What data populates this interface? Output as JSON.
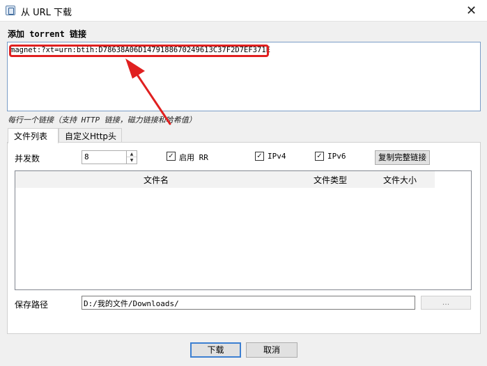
{
  "window": {
    "title": "从 URL 下载",
    "close_glyph": "✕"
  },
  "section_title": "添加 torrent 链接",
  "links_text": "magnet:?xt=urn:btih:D78638A06D1479188670249613C37F2D7EF371E",
  "hint": "每行一个链接（支持 HTTP 链接，磁力链接和哈希值）",
  "tabs": [
    {
      "label": "文件列表",
      "active": true
    },
    {
      "label": "自定义Http头",
      "active": false
    }
  ],
  "options": {
    "concurrency_label": "并发数",
    "concurrency_value": "8",
    "enable_rr_label": "启用 RR",
    "enable_rr_checked": true,
    "ipv4_label": "IPv4",
    "ipv4_checked": true,
    "ipv6_label": "IPv6",
    "ipv6_checked": true,
    "copy_link_button": "复制完整链接"
  },
  "file_list": {
    "columns": [
      "文件名",
      "文件类型",
      "文件大小"
    ],
    "rows": []
  },
  "save_path": {
    "label": "保存路径",
    "value": "D:/我的文件/Downloads/",
    "browse_button": "..."
  },
  "buttons": {
    "ok": "下载",
    "cancel": "取消"
  },
  "annotation": {
    "color": "#e02020"
  },
  "icons": {
    "check": "✓",
    "spin_up": "▲",
    "spin_down": "▼"
  }
}
